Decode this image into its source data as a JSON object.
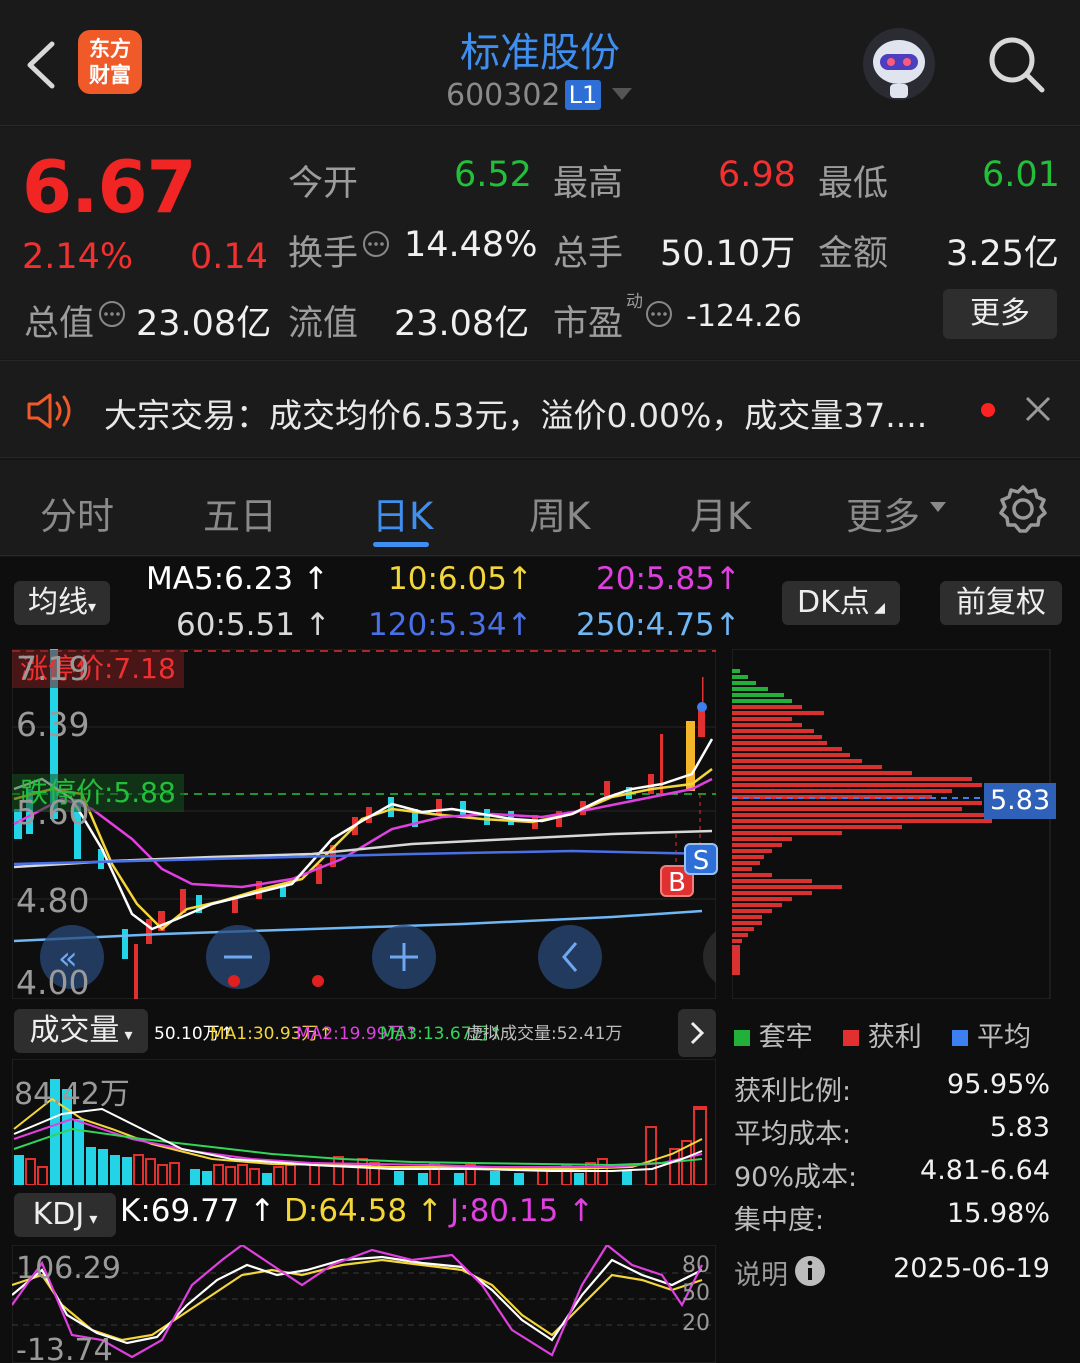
{
  "header": {
    "back_icon": "chevron-left-icon",
    "logo_text_line1": "东方",
    "logo_text_line2": "财富",
    "title": "标准股份",
    "code": "600302",
    "level_badge": "L1",
    "avatar_icon": "robot-avatar-icon",
    "search_icon": "search-icon"
  },
  "quote": {
    "price": "6.67",
    "change_pct": "2.14%",
    "change": "0.14",
    "open_label": "今开",
    "open": "6.52",
    "high_label": "最高",
    "high": "6.98",
    "low_label": "最低",
    "low": "6.01",
    "turnover_label": "换手",
    "turnover": "14.48%",
    "volume_label": "总手",
    "volume": "50.10万",
    "amount_label": "金额",
    "amount": "3.25亿",
    "mktcap_label": "总值",
    "mktcap": "23.08亿",
    "float_label": "流值",
    "float_cap": "23.08亿",
    "pe_label": "市盈",
    "pe_sup": "动",
    "pe": "-124.26",
    "more_label": "更多"
  },
  "notice": {
    "text": "大宗交易：成交均价6.53元，溢价0.00%，成交量37....",
    "close_icon": "close-icon"
  },
  "tabs": [
    "分时",
    "五日",
    "日K",
    "周K",
    "月K",
    "更多"
  ],
  "active_tab": "日K",
  "chart_controls": {
    "ma_dropdown": "均线",
    "dk_label": "DK点",
    "adjust_label": "前复权",
    "ma_values": [
      {
        "label": "MA5:6.23",
        "color": "#ffffff"
      },
      {
        "label": "10:6.05",
        "color": "#f3d63a"
      },
      {
        "label": "20:5.85",
        "color": "#e040e0"
      },
      {
        "label": "60:5.51",
        "color": "#d8d8d8"
      },
      {
        "label": "120:5.34",
        "color": "#4a70e8"
      },
      {
        "label": "250:4.75",
        "color": "#6fb7f5"
      }
    ]
  },
  "kline": {
    "limit_up": "涨停价:7.18",
    "limit_down": "跌停价:5.88",
    "axis": [
      "7.19",
      "6.39",
      "5.60",
      "4.80",
      "4.00"
    ],
    "chip_price": "5.83",
    "buy_marker": "B",
    "sell_marker": "S"
  },
  "volume": {
    "dropdown": "成交量",
    "legend": [
      {
        "text": "50.10万",
        "color": "#ffffff"
      },
      {
        "text": "MA1:30.93万",
        "color": "#f3d63a"
      },
      {
        "text": "MA2:19.99万",
        "color": "#e040e0"
      },
      {
        "text": "MA3:13.67万",
        "color": "#33d45a"
      },
      {
        "text": "虚拟成交量:52.41万",
        "color": "#bdbdbd"
      }
    ],
    "max_label": "84.42万"
  },
  "kdj": {
    "dropdown": "KDJ",
    "k": "K:69.77",
    "d": "D:64.58",
    "j": "J:80.15",
    "top_label": "106.29",
    "bottom_label": "-13.74",
    "levels": [
      "80",
      "50",
      "20"
    ]
  },
  "chips": {
    "legend": [
      {
        "label": "套牢",
        "color": "#22b03a"
      },
      {
        "label": "获利",
        "color": "#e03030"
      },
      {
        "label": "平均",
        "color": "#3d7ef0"
      }
    ],
    "rows": [
      {
        "label": "获利比例:",
        "value": "95.95%"
      },
      {
        "label": "平均成本:",
        "value": "5.83"
      },
      {
        "label": "90%成本:",
        "value": "4.81-6.64"
      },
      {
        "label": "集中度:",
        "value": "15.98%"
      }
    ],
    "note_label": "说明",
    "date": "2025-06-19"
  }
}
